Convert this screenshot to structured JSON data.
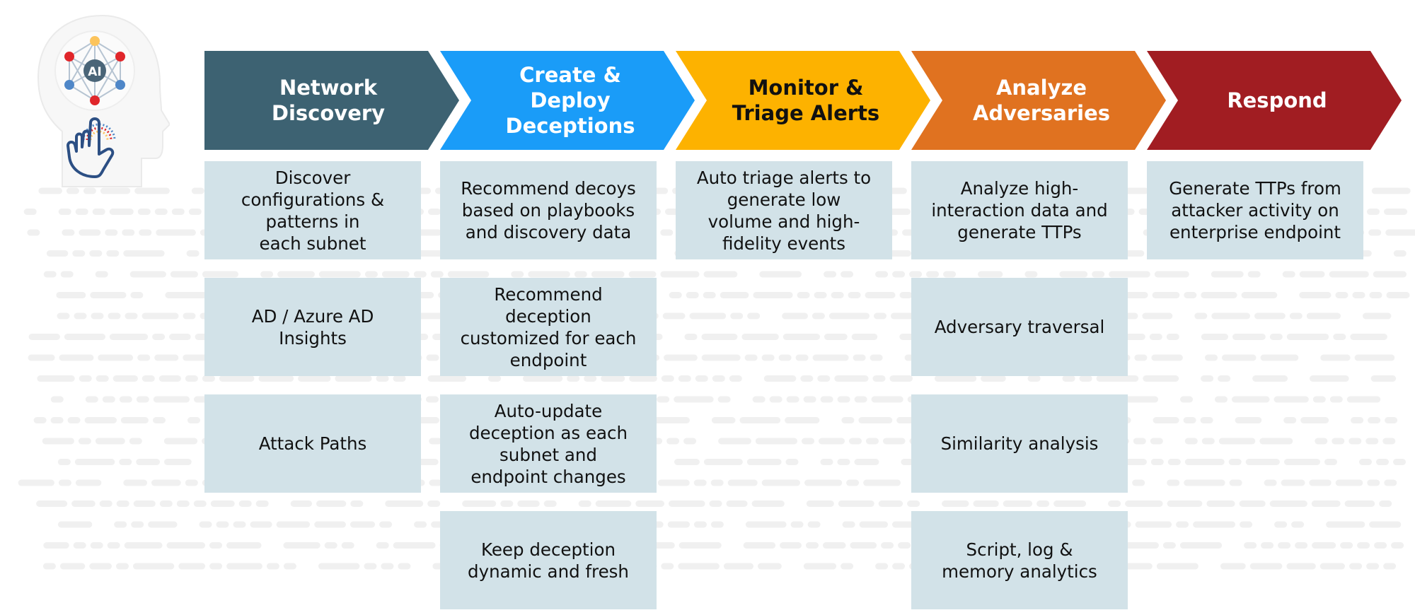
{
  "diagram": {
    "stages": [
      {
        "title": "Network\nDiscovery",
        "color": "#3d6272",
        "text_color": "#ffffff",
        "items": [
          "Discover\nconfigurations &\npatterns in\neach subnet",
          "AD / Azure AD\nInsights",
          "Attack Paths"
        ]
      },
      {
        "title": "Create &\nDeploy\nDeceptions",
        "color": "#1a9cf8",
        "text_color": "#ffffff",
        "items": [
          "Recommend decoys\nbased on playbooks\nand discovery data",
          "Recommend\ndeception\ncustomized for each\nendpoint",
          "Auto-update\ndeception as each\nsubnet and\nendpoint changes",
          "Keep deception\ndynamic and fresh"
        ]
      },
      {
        "title": "Monitor &\nTriage Alerts",
        "color": "#fdb200",
        "text_color": "#111111",
        "items": [
          "Auto triage alerts to\ngenerate low\nvolume and high-\nfidelity events"
        ]
      },
      {
        "title": "Analyze\nAdversaries",
        "color": "#e07220",
        "text_color": "#ffffff",
        "items": [
          "Analyze high-\ninteraction data and\ngenerate TTPs",
          "Adversary traversal",
          "Similarity analysis",
          "Script, log &\nmemory analytics"
        ]
      },
      {
        "title": "Respond",
        "color": "#a11d22",
        "text_color": "#ffffff",
        "items": [
          "Generate TTPs from\nattacker activity on\nenterprise endpoint"
        ]
      }
    ],
    "card_color": "#d2e2e8",
    "logo": {
      "icon": "ai-head-touch-icon",
      "badge_text": "AI",
      "node_colors": [
        "#fcc45c",
        "#e0262b",
        "#4f87c8",
        "#e0262b"
      ],
      "hand_color": "#2c4f84"
    }
  }
}
